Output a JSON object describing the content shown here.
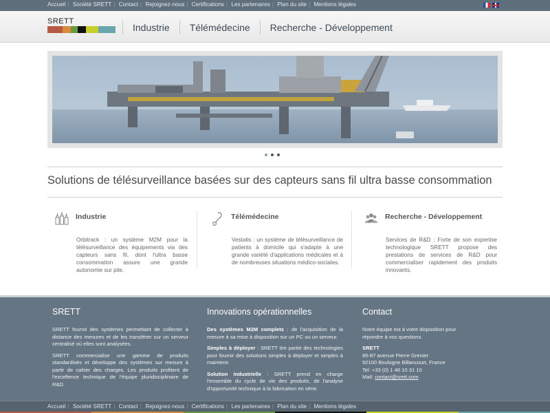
{
  "top_nav": {
    "links": [
      "Accueil",
      "Société SRETT",
      "Contact",
      "Rejoignez-nous",
      "Certifications",
      "Les partenaires",
      "Plan du site",
      "Mentions légales"
    ]
  },
  "languages": [
    {
      "code": "fr",
      "icon": "flag-fr-icon"
    },
    {
      "code": "en",
      "icon": "flag-uk-icon"
    }
  ],
  "logo": {
    "text": "SRETT",
    "colors": [
      "#b75a44",
      "#d98a3a",
      "#6a9a3c",
      "#111111",
      "#c9cf2a",
      "#6aa5ac"
    ]
  },
  "main_nav": {
    "items": [
      "Industrie",
      "Télémédecine",
      "Recherche - Développement"
    ]
  },
  "slider": {
    "slide_count": 3,
    "active_index": 0
  },
  "headline": "Solutions de télésurveillance basées sur des capteurs sans fil ultra basse consommation",
  "features": [
    {
      "icon": "factory-icon",
      "title": "Industrie",
      "text": "Orbitrack : un système M2M pour la télésurveillance des équipements via des capteurs sans fil, dont l'ultra basse consommation assure une grande autonomie sur pile."
    },
    {
      "icon": "stethoscope-icon",
      "title": "Télémédecine",
      "text": "Vestalis : un système de télésurveillance de patients à domicile qui s'adapte à une grande variété d'applications médicales et à de nombreuses situations médico-sociales."
    },
    {
      "icon": "team-icon",
      "title": "Recherche - Développement",
      "text": "Services de R&D : Forte de son expertise technologique SRETT propose des prestations de services de R&D pour commercialiser rapidement des produits innovants."
    }
  ],
  "footer": {
    "about": {
      "title": "SRETT",
      "p1": "SRETT fournit des systèmes permettant de collecter à distance des mesures et de les transférer sur un serveur centralisé où elles sont analysées.",
      "p2": "SRETT commercialise une gamme de produits standardisés et développe des systèmes sur mesure à partir de cahier des charges. Les produits profitent de l'excellence technique de l'équipe pluridisciplinaire de R&D."
    },
    "innovations": {
      "title": "Innovations opérationnelles",
      "items": [
        {
          "bold": "Des systèmes M2M complets",
          "text": " : de l'acquisition de la mesure à sa mise à disposition sur un PC ou un serveur."
        },
        {
          "bold": "Simples à déployer",
          "text": " : SRETT tire partie des technologies pour fournir des solutions simples à déployer et simples à maintenir."
        },
        {
          "bold": "Solution industrielle",
          "text": " : SRETT prend en charge l'ensemble du cycle de vie des produits, de l'analyse d'opportunité technique à la fabrication en série."
        }
      ]
    },
    "contact": {
      "title": "Contact",
      "intro": "Notre équipe est à votre disposition pour répondre à vos questions.",
      "company": "SRETT",
      "street": "85-87 avenue Pierre Grenier",
      "city": "92100 Boulogne Billancourt, France",
      "tel": "Tel: +33 (0) 1 46 10 31 10",
      "mail_label": "Mail: ",
      "mail": "contact@srett.com"
    }
  },
  "bottom_nav": {
    "links": [
      "Accueil",
      "Société SRETT",
      "Contact",
      "Rejoignez-nous",
      "Certifications",
      "Les partenaires",
      "Plan du site",
      "Mentions légales"
    ]
  }
}
